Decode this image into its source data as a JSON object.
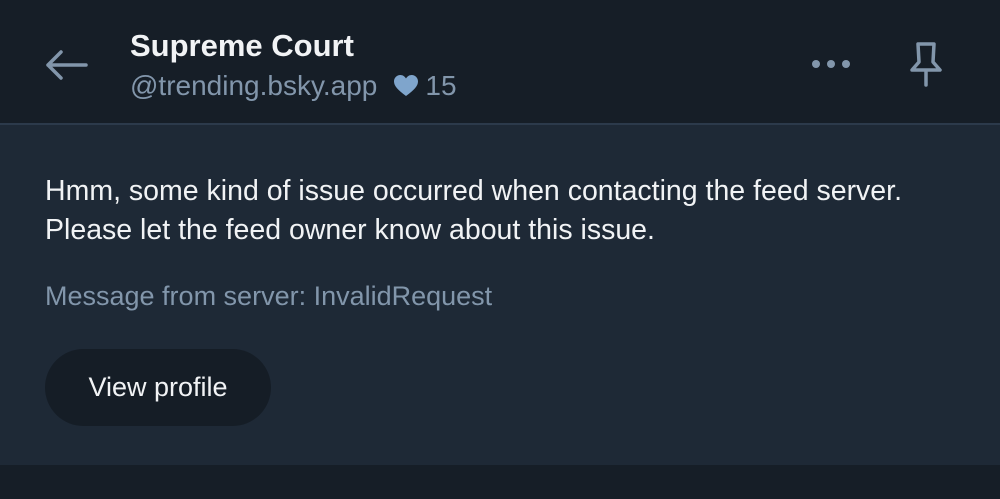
{
  "header": {
    "title": "Supreme Court",
    "handle": "@trending.bsky.app",
    "like_count": "15",
    "icons": {
      "back": "arrow-left-icon",
      "like": "heart-icon",
      "more": "ellipsis-icon",
      "pin": "pin-icon"
    }
  },
  "error": {
    "message": "Hmm, some kind of issue occurred when contacting the feed server. Please let the feed owner know about this issue.",
    "server_message": "Message from server: InvalidRequest"
  },
  "actions": {
    "view_profile_label": "View profile"
  },
  "colors": {
    "background": "#161e27",
    "panel": "#1e2936",
    "text": "#f1f3f5",
    "muted_text": "#8296ab",
    "button": "#151d26",
    "divider": "#2c3a4b",
    "heart": "#7fa5cc"
  }
}
